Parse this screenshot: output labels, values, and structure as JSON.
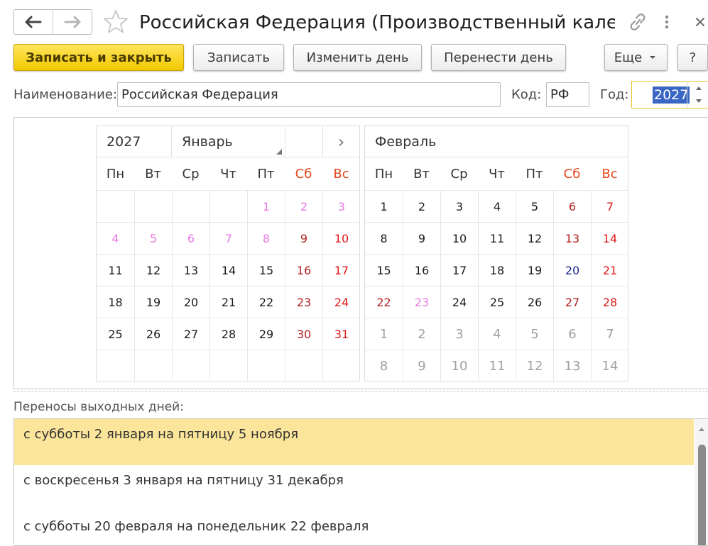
{
  "window": {
    "title": "Российская Федерация (Производственный кале…"
  },
  "toolbar": {
    "save_close": "Записать и закрыть",
    "save": "Записать",
    "change_day": "Изменить день",
    "move_day": "Перенести день",
    "more": "Еще",
    "help": "?"
  },
  "form": {
    "name_label": "Наименование:",
    "name_value": "Российская Федерация",
    "code_label": "Код:",
    "code_value": "РФ",
    "year_label": "Год:",
    "year_value": "2027"
  },
  "colors": {
    "normal": "#1b1b1b",
    "holiday": "#e01818",
    "saturday": "#b21f1f",
    "holiday_light": "#e878e0",
    "transfer": "#1e2a8a",
    "other_month": "#a0a0a0"
  },
  "calendar": {
    "weekdays": [
      "Пн",
      "Вт",
      "Ср",
      "Чт",
      "Пт",
      "Сб",
      "Вс"
    ],
    "months": [
      {
        "year": "2027",
        "name": "Январь",
        "next_icon": "›",
        "rows": [
          [
            {
              "d": "",
              "t": "normal"
            },
            {
              "d": "",
              "t": "normal"
            },
            {
              "d": "",
              "t": "normal"
            },
            {
              "d": "",
              "t": "normal"
            },
            {
              "d": "1",
              "t": "holiday_light"
            },
            {
              "d": "2",
              "t": "holiday_light"
            },
            {
              "d": "3",
              "t": "holiday_light"
            }
          ],
          [
            {
              "d": "4",
              "t": "holiday_light"
            },
            {
              "d": "5",
              "t": "holiday_light"
            },
            {
              "d": "6",
              "t": "holiday_light"
            },
            {
              "d": "7",
              "t": "holiday_light"
            },
            {
              "d": "8",
              "t": "holiday_light"
            },
            {
              "d": "9",
              "t": "saturday"
            },
            {
              "d": "10",
              "t": "holiday"
            }
          ],
          [
            {
              "d": "11",
              "t": "normal"
            },
            {
              "d": "12",
              "t": "normal"
            },
            {
              "d": "13",
              "t": "normal"
            },
            {
              "d": "14",
              "t": "normal"
            },
            {
              "d": "15",
              "t": "normal"
            },
            {
              "d": "16",
              "t": "saturday"
            },
            {
              "d": "17",
              "t": "holiday"
            }
          ],
          [
            {
              "d": "18",
              "t": "normal"
            },
            {
              "d": "19",
              "t": "normal"
            },
            {
              "d": "20",
              "t": "normal"
            },
            {
              "d": "21",
              "t": "normal"
            },
            {
              "d": "22",
              "t": "normal"
            },
            {
              "d": "23",
              "t": "saturday"
            },
            {
              "d": "24",
              "t": "holiday"
            }
          ],
          [
            {
              "d": "25",
              "t": "normal"
            },
            {
              "d": "26",
              "t": "normal"
            },
            {
              "d": "27",
              "t": "normal"
            },
            {
              "d": "28",
              "t": "normal"
            },
            {
              "d": "29",
              "t": "normal"
            },
            {
              "d": "30",
              "t": "saturday"
            },
            {
              "d": "31",
              "t": "holiday"
            }
          ],
          [
            {
              "d": "",
              "t": "normal"
            },
            {
              "d": "",
              "t": "normal"
            },
            {
              "d": "",
              "t": "normal"
            },
            {
              "d": "",
              "t": "normal"
            },
            {
              "d": "",
              "t": "normal"
            },
            {
              "d": "",
              "t": "normal"
            },
            {
              "d": "",
              "t": "normal"
            }
          ]
        ]
      },
      {
        "name": "Февраль",
        "rows": [
          [
            {
              "d": "1",
              "t": "normal"
            },
            {
              "d": "2",
              "t": "normal"
            },
            {
              "d": "3",
              "t": "normal"
            },
            {
              "d": "4",
              "t": "normal"
            },
            {
              "d": "5",
              "t": "normal"
            },
            {
              "d": "6",
              "t": "saturday"
            },
            {
              "d": "7",
              "t": "holiday"
            }
          ],
          [
            {
              "d": "8",
              "t": "normal"
            },
            {
              "d": "9",
              "t": "normal"
            },
            {
              "d": "10",
              "t": "normal"
            },
            {
              "d": "11",
              "t": "normal"
            },
            {
              "d": "12",
              "t": "normal"
            },
            {
              "d": "13",
              "t": "saturday"
            },
            {
              "d": "14",
              "t": "holiday"
            }
          ],
          [
            {
              "d": "15",
              "t": "normal"
            },
            {
              "d": "16",
              "t": "normal"
            },
            {
              "d": "17",
              "t": "normal"
            },
            {
              "d": "18",
              "t": "normal"
            },
            {
              "d": "19",
              "t": "normal"
            },
            {
              "d": "20",
              "t": "transfer"
            },
            {
              "d": "21",
              "t": "holiday"
            }
          ],
          [
            {
              "d": "22",
              "t": "saturday"
            },
            {
              "d": "23",
              "t": "holiday_light"
            },
            {
              "d": "24",
              "t": "normal"
            },
            {
              "d": "25",
              "t": "normal"
            },
            {
              "d": "26",
              "t": "normal"
            },
            {
              "d": "27",
              "t": "saturday"
            },
            {
              "d": "28",
              "t": "holiday"
            }
          ],
          [
            {
              "d": "1",
              "t": "other_month"
            },
            {
              "d": "2",
              "t": "other_month"
            },
            {
              "d": "3",
              "t": "other_month"
            },
            {
              "d": "4",
              "t": "other_month"
            },
            {
              "d": "5",
              "t": "other_month"
            },
            {
              "d": "6",
              "t": "other_month"
            },
            {
              "d": "7",
              "t": "other_month"
            }
          ],
          [
            {
              "d": "8",
              "t": "other_month"
            },
            {
              "d": "9",
              "t": "other_month"
            },
            {
              "d": "10",
              "t": "other_month"
            },
            {
              "d": "11",
              "t": "other_month"
            },
            {
              "d": "12",
              "t": "other_month"
            },
            {
              "d": "13",
              "t": "other_month"
            },
            {
              "d": "14",
              "t": "other_month"
            }
          ]
        ]
      }
    ]
  },
  "transfers": {
    "label": "Переносы выходных дней:",
    "items": [
      "с субботы 2 января на пятницу 5 ноября",
      "с воскресенья 3 января на пятницу 31 декабря",
      "с субботы 20 февраля на понедельник 22 февраля"
    ]
  }
}
